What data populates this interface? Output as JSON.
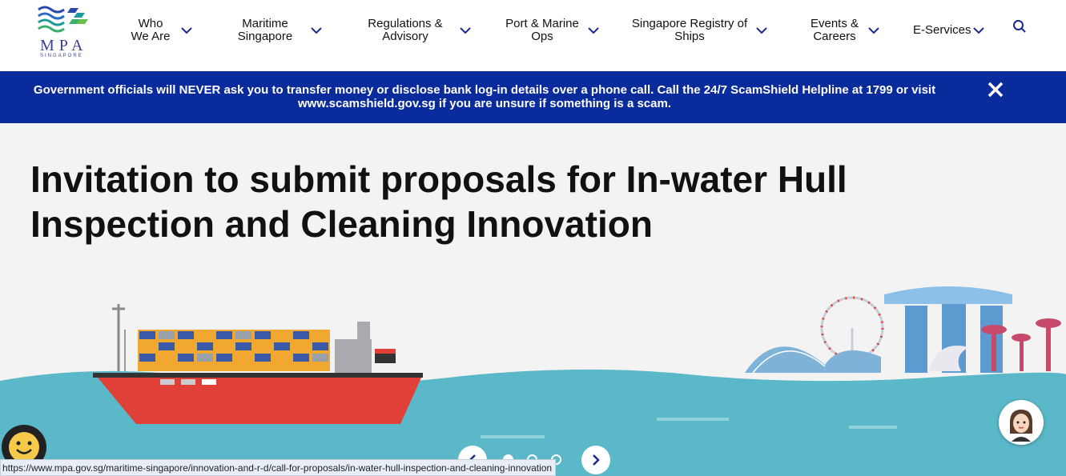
{
  "logo": {
    "text": "MPA",
    "subtext": "SINGAPORE"
  },
  "nav": [
    {
      "label": "Who We Are",
      "icon": "chevron-down-icon"
    },
    {
      "label": "Maritime Singapore",
      "icon": "chevron-down-icon"
    },
    {
      "label": "Regulations & Advisory",
      "icon": "chevron-down-icon"
    },
    {
      "label": "Port & Marine Ops",
      "icon": "chevron-down-icon"
    },
    {
      "label": "Singapore Registry of Ships",
      "icon": "chevron-down-icon"
    },
    {
      "label": "Events & Careers",
      "icon": "chevron-down-icon"
    },
    {
      "label": "E-Services",
      "icon": "chevron-down-icon"
    }
  ],
  "search_icon": "search-icon",
  "banner": {
    "text": "Government officials will NEVER ask you to transfer money or disclose bank log-in details over a phone call. Call the 24/7 ScamShield Helpline at 1799 or visit www.scamshield.gov.sg if you are unsure if something is a scam.",
    "close_icon": "close-icon"
  },
  "hero": {
    "title": "Invitation to submit proposals for In-water Hull Inspection and Cleaning Innovation",
    "slide_count": 3,
    "active_slide": 1
  },
  "status_bar": {
    "url": "https://www.mpa.gov.sg/maritime-singapore/innovation-and-r-d/call-for-proposals/in-water-hull-inspection-and-cleaning-innovation"
  },
  "colors": {
    "banner_bg": "#0a2b9c",
    "accent": "#1a2a8c",
    "sea": "#5ab8c8",
    "ship_hull": "#e04038"
  }
}
